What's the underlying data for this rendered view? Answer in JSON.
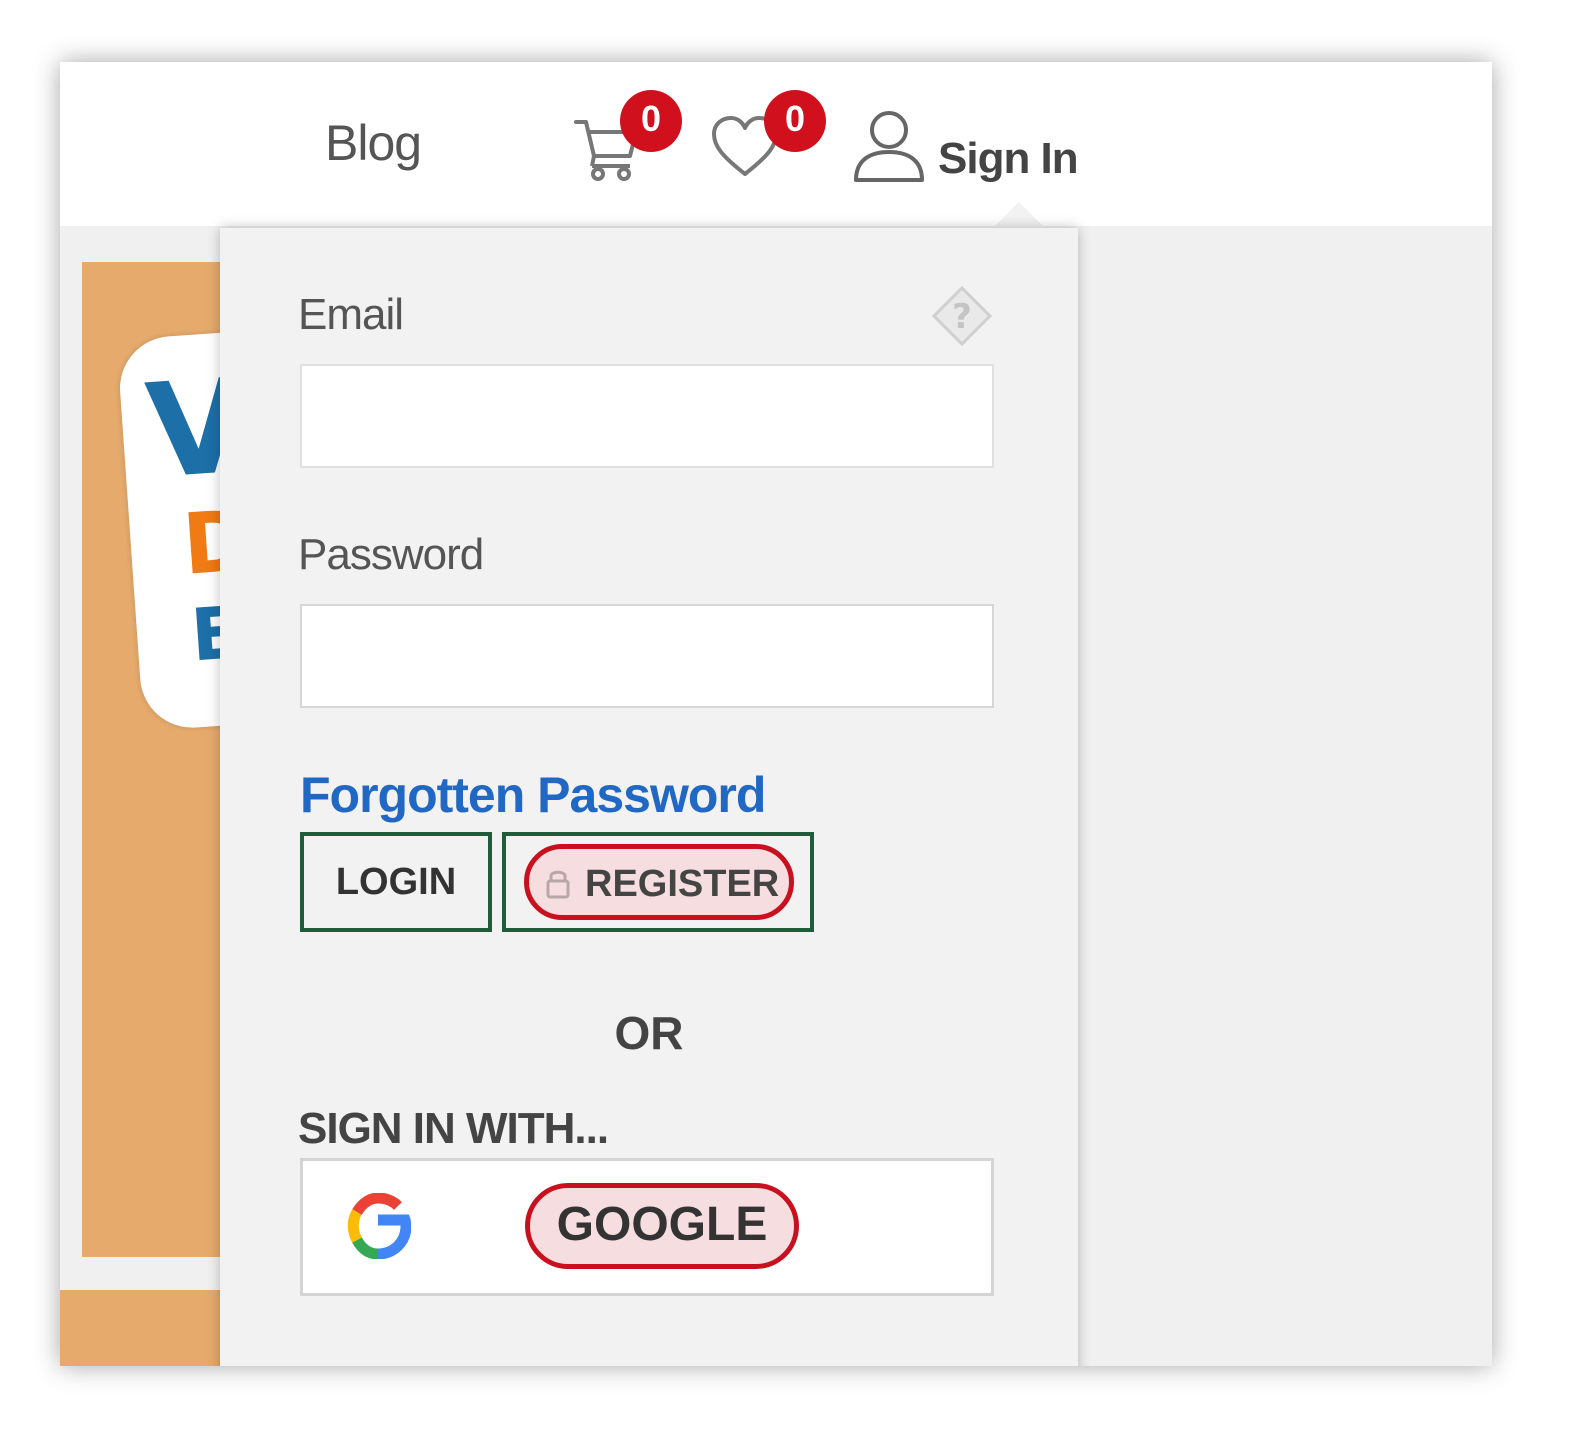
{
  "nav": {
    "blog_label": "Blog",
    "cart_count": "0",
    "wishlist_count": "0",
    "signin_label": "Sign In"
  },
  "banner": {
    "letters": [
      "V",
      "D",
      "E"
    ]
  },
  "login_form": {
    "email_label": "Email",
    "email_value": "",
    "password_label": "Password",
    "password_value": "",
    "forgot_link": "Forgotten Password",
    "login_button": "LOGIN",
    "register_button": "REGISTER",
    "or_text": "OR",
    "sign_in_with": "SIGN IN WITH...",
    "google_button": "GOOGLE"
  },
  "icons": {
    "cart": "shopping-cart-icon",
    "wishlist": "heart-icon",
    "user": "user-icon",
    "help": "help-icon",
    "lock": "lock-icon",
    "google": "google-logo-icon"
  },
  "colors": {
    "badge": "#d0101c",
    "link": "#2168c4",
    "highlight_outline": "#c8101e",
    "button_outline": "#1e5c3a",
    "banner": "#e5aa6c"
  }
}
